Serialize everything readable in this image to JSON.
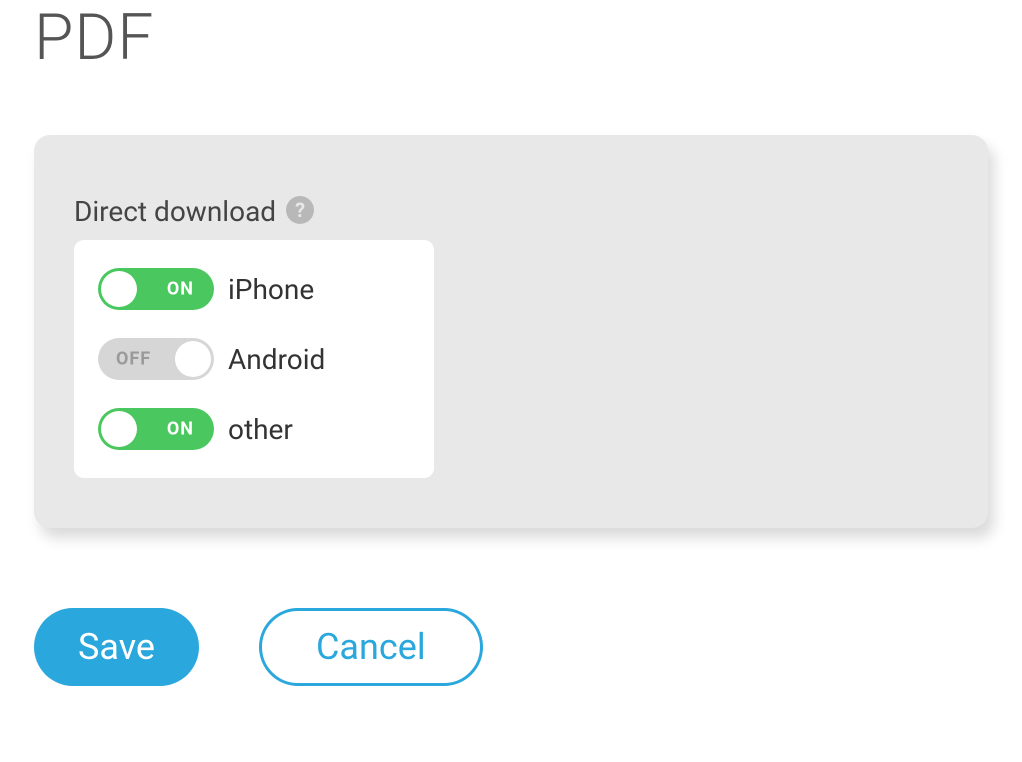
{
  "page": {
    "title": "PDF"
  },
  "section": {
    "label": "Direct download"
  },
  "toggles": {
    "on_label": "ON",
    "off_label": "OFF",
    "items": [
      {
        "label": "iPhone",
        "state": "on"
      },
      {
        "label": "Android",
        "state": "off"
      },
      {
        "label": "other",
        "state": "on"
      }
    ]
  },
  "buttons": {
    "save": "Save",
    "cancel": "Cancel"
  }
}
